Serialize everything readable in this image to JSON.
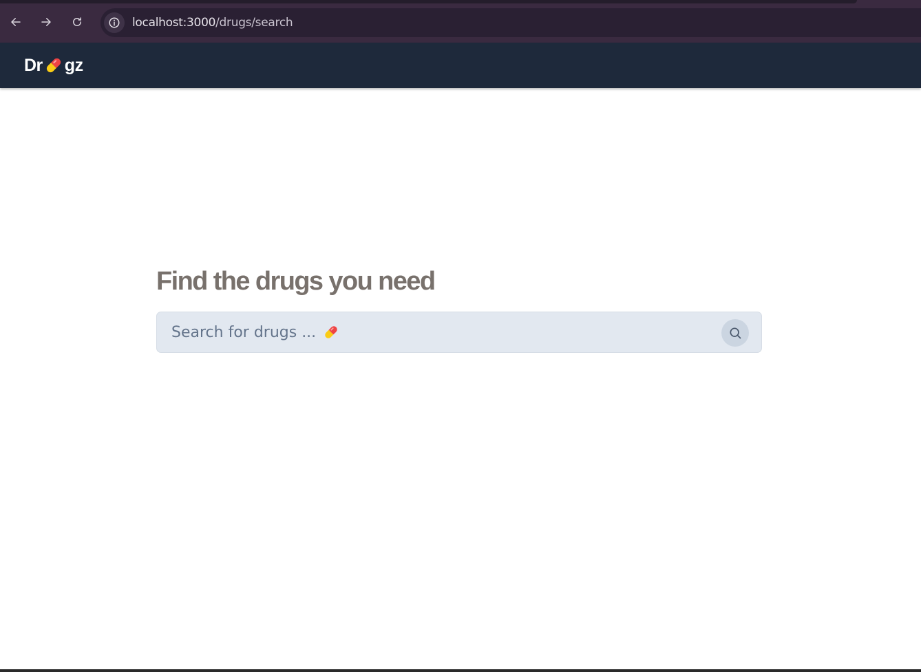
{
  "browser": {
    "url_host": "localhost:3000",
    "url_path": "/drugs/search"
  },
  "app": {
    "logo_prefix": "Dr",
    "logo_suffix": "gz",
    "logo_icon": "pill-icon"
  },
  "main": {
    "heading": "Find the drugs you need",
    "search": {
      "placeholder": "Search for drugs ...",
      "value": "",
      "icon": "pill-icon",
      "button_icon": "search-icon"
    }
  },
  "colors": {
    "header_bg": "#1e293b",
    "heading": "#78716c",
    "search_bg": "#e2e8f0",
    "search_button_bg": "#cbd5e1",
    "pill_red": "#ef4444",
    "pill_yellow": "#facc15"
  }
}
